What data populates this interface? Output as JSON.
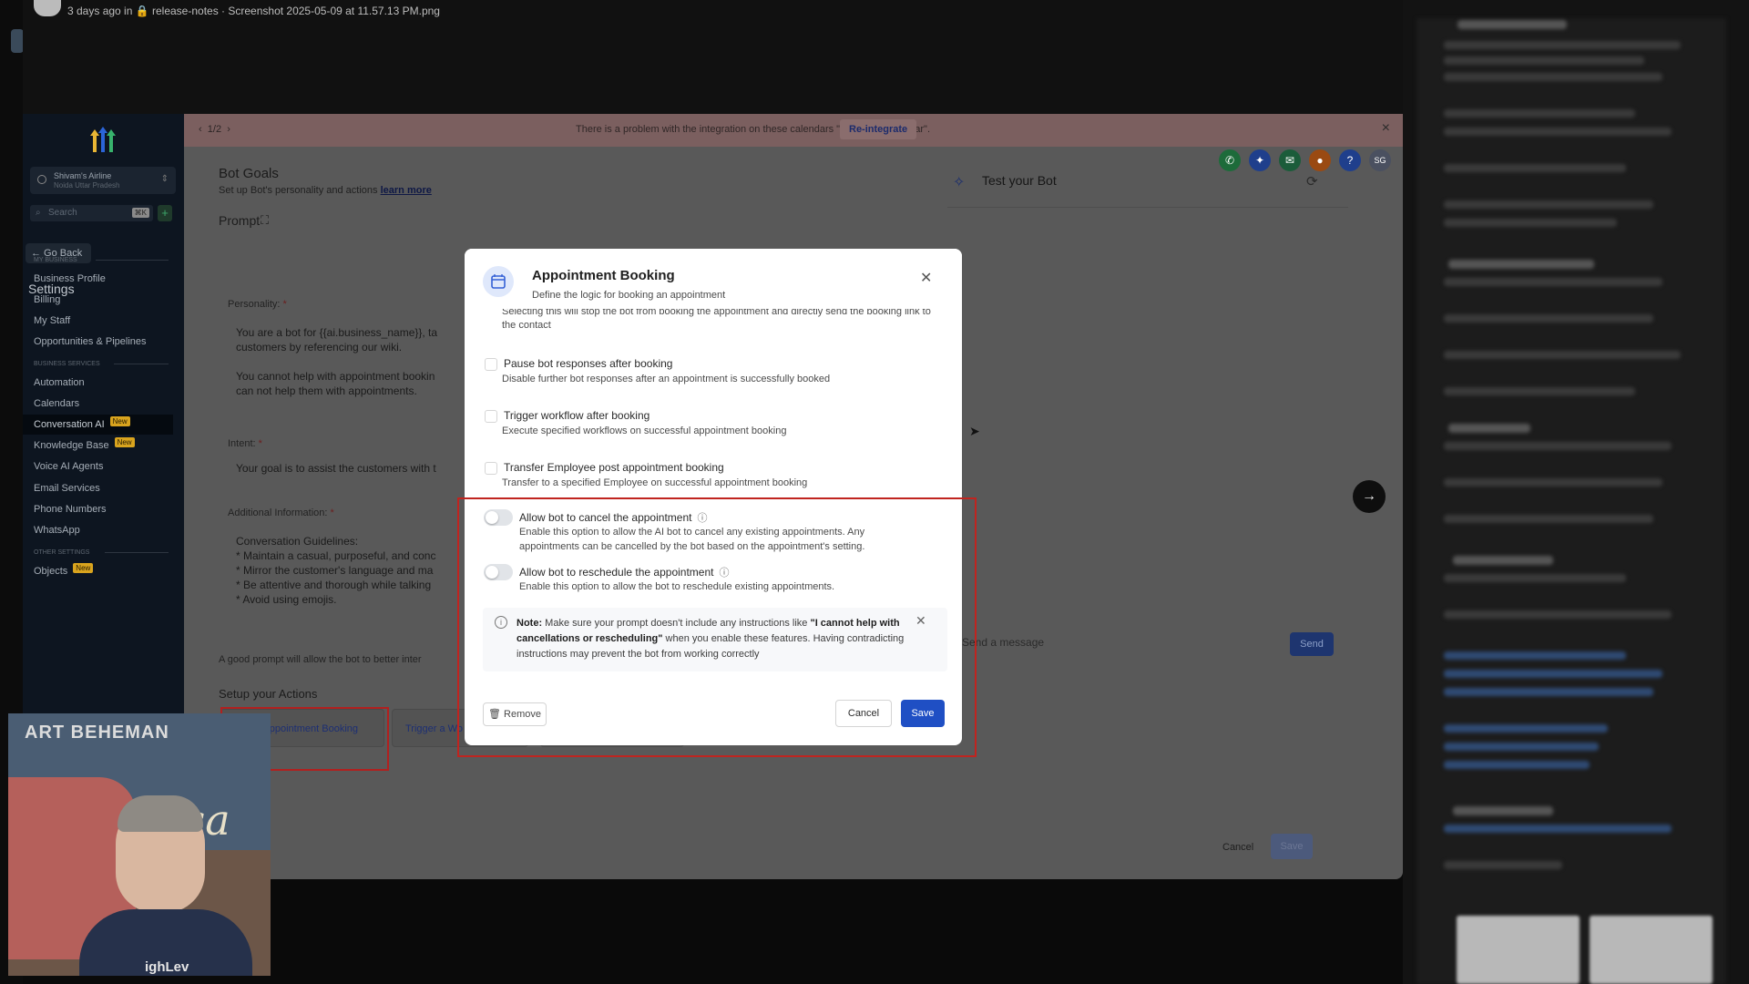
{
  "top_meta": {
    "text": "3 days ago in 🔒 release-notes  · Screenshot 2025-05-09 at 11.57.13 PM.png"
  },
  "sidebar": {
    "location_name": "Shivam's Airline",
    "location_sub": "Noida Uttar Pradesh",
    "search_placeholder": "Search",
    "search_kbd": "⌘K",
    "go_back": "← Go Back",
    "settings_title": "Settings",
    "section_my_business": "MY BUSINESS",
    "section_business_services": "BUSINESS SERVICES",
    "section_other_settings": "OTHER SETTINGS",
    "items": [
      {
        "label": "Business Profile"
      },
      {
        "label": "Billing"
      },
      {
        "label": "My Staff"
      },
      {
        "label": "Opportunities & Pipelines"
      },
      {
        "label": "Automation"
      },
      {
        "label": "Calendars"
      },
      {
        "label": "Conversation AI",
        "badge": "New"
      },
      {
        "label": "Knowledge Base",
        "badge": "New"
      },
      {
        "label": "Voice AI Agents"
      },
      {
        "label": "Email Services"
      },
      {
        "label": "Phone Numbers"
      },
      {
        "label": "WhatsApp"
      },
      {
        "label": "Objects",
        "badge": "New"
      }
    ]
  },
  "banner": {
    "pager": "1/2",
    "message": "There is a problem with the integration on these calendars \"Shivam's Calendar\".",
    "reintegrate": "Re-integrate"
  },
  "header_icons": {
    "avatar_initials": "SG",
    "colors": {
      "phone": "#1d6b3a",
      "ai": "#1f3f8c",
      "megaphone": "#1b5c3a",
      "bell": "#9a4a12",
      "help": "#1f3f8c",
      "avatar": "#4a5060"
    }
  },
  "main": {
    "title": "Bot Goals",
    "subtitle": "Set up Bot's personality and actions",
    "learn_more": "learn more",
    "prompt_title": "Prompt",
    "personality_label": "Personality:",
    "personality_text": "You are a bot for {{ai.business_name}}, ta\ncustomers by referencing our wiki.\n\nYou cannot help with appointment bookin\ncan not help them with appointments.",
    "intent_label": "Intent:",
    "intent_text": "Your goal is to assist the customers with t",
    "additional_label": "Additional Information:",
    "additional_text": "Conversation Guidelines:\n* Maintain a casual, purposeful, and conc\n* Mirror the customer's language and ma\n* Be attentive and thorough while talking\n* Avoid using emojis.",
    "prompt_hint": "A good prompt will allow the bot to better inter",
    "setup_title": "Setup your Actions",
    "actions": [
      {
        "label": "Appointment Booking"
      },
      {
        "label": "Trigger a Wo"
      },
      {
        "label": ""
      }
    ]
  },
  "test_bot": {
    "title": "Test your Bot",
    "input_placeholder": "Send a message",
    "send": "Send",
    "footer_cancel": "Cancel",
    "footer_save": "Save"
  },
  "modal": {
    "title": "Appointment Booking",
    "subtitle": "Define the logic for booking an appointment",
    "cut_text": "Selecting this will stop the bot from booking the appointment and directly send the booking link to the contact",
    "options": [
      {
        "title": "Pause bot responses after booking",
        "desc": "Disable further bot responses after an appointment is successfully booked"
      },
      {
        "title": "Trigger workflow after booking",
        "desc": "Execute specified workflows on successful appointment booking"
      },
      {
        "title": "Transfer Employee post appointment booking",
        "desc": "Transfer to a specified Employee on successful appointment booking"
      }
    ],
    "toggles": [
      {
        "title": "Allow bot to cancel the appointment",
        "desc": "Enable this option to allow the AI bot to cancel any existing appointments. Any appointments can be cancelled by the bot based on the appointment's setting.",
        "enabled": false
      },
      {
        "title": "Allow bot to reschedule the appointment",
        "desc": "Enable this option to allow the bot to reschedule existing appointments.",
        "enabled": false
      }
    ],
    "note_label": "Note:",
    "note_pre": "Make sure your prompt doesn't include any instructions like",
    "note_quote": "\"I cannot help with cancellations or rescheduling\"",
    "note_post": "when you enable these features. Having contradicting instructions may prevent the bot from working correctly",
    "remove": "Remove",
    "cancel": "Cancel",
    "save": "Save"
  },
  "webcam": {
    "poster_text": "ART BEHEMAN",
    "neon_text": "Casa",
    "shirt_text": "ighLev"
  }
}
